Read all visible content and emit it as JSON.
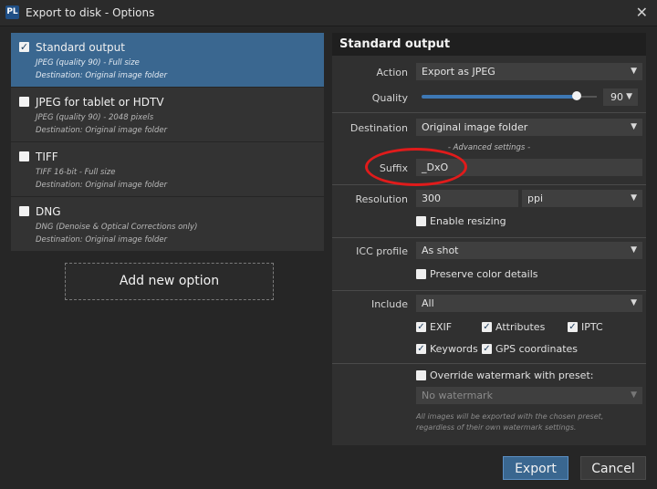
{
  "window": {
    "logo": "PL",
    "title": "Export to disk - Options",
    "close_glyph": "✕"
  },
  "options": [
    {
      "name": "Standard output",
      "line1": "JPEG (quality 90) - Full size",
      "line2": "Destination: Original image folder",
      "checked": true,
      "selected": true
    },
    {
      "name": "JPEG for tablet or HDTV",
      "line1": "JPEG (quality 90) - 2048 pixels",
      "line2": "Destination: Original image folder",
      "checked": false,
      "selected": false
    },
    {
      "name": "TIFF",
      "line1": "TIFF 16-bit - Full size",
      "line2": "Destination: Original image folder",
      "checked": false,
      "selected": false
    },
    {
      "name": "DNG",
      "line1": "DNG (Denoise & Optical Corrections only)",
      "line2": "Destination: Original image folder",
      "checked": false,
      "selected": false
    }
  ],
  "add_option_label": "Add new option",
  "panel": {
    "title": "Standard output",
    "action_label": "Action",
    "action_value": "Export as JPEG",
    "quality_label": "Quality",
    "quality_value": "90",
    "quality_fraction": 0.9,
    "destination_label": "Destination",
    "destination_value": "Original image folder",
    "advanced_settings": "- Advanced settings -",
    "suffix_label": "Suffix",
    "suffix_value": "_DxO",
    "resolution_label": "Resolution",
    "resolution_value": "300",
    "resolution_unit": "ppi",
    "enable_resizing": "Enable resizing",
    "icc_label": "ICC profile",
    "icc_value": "As shot",
    "preserve_color": "Preserve color details",
    "include_label": "Include",
    "include_value": "All",
    "exif": "EXIF",
    "attributes": "Attributes",
    "iptc": "IPTC",
    "keywords": "Keywords",
    "gps": "GPS coordinates",
    "override_watermark": "Override watermark with preset:",
    "watermark_value": "No watermark",
    "note": "All images will be exported with the chosen preset, regardless of their own watermark settings."
  },
  "buttons": {
    "export": "Export",
    "cancel": "Cancel"
  },
  "colors": {
    "accent": "#3a6790",
    "annotation": "#e01b1b"
  },
  "glyphs": {
    "check": "✓",
    "caret": "▼"
  }
}
